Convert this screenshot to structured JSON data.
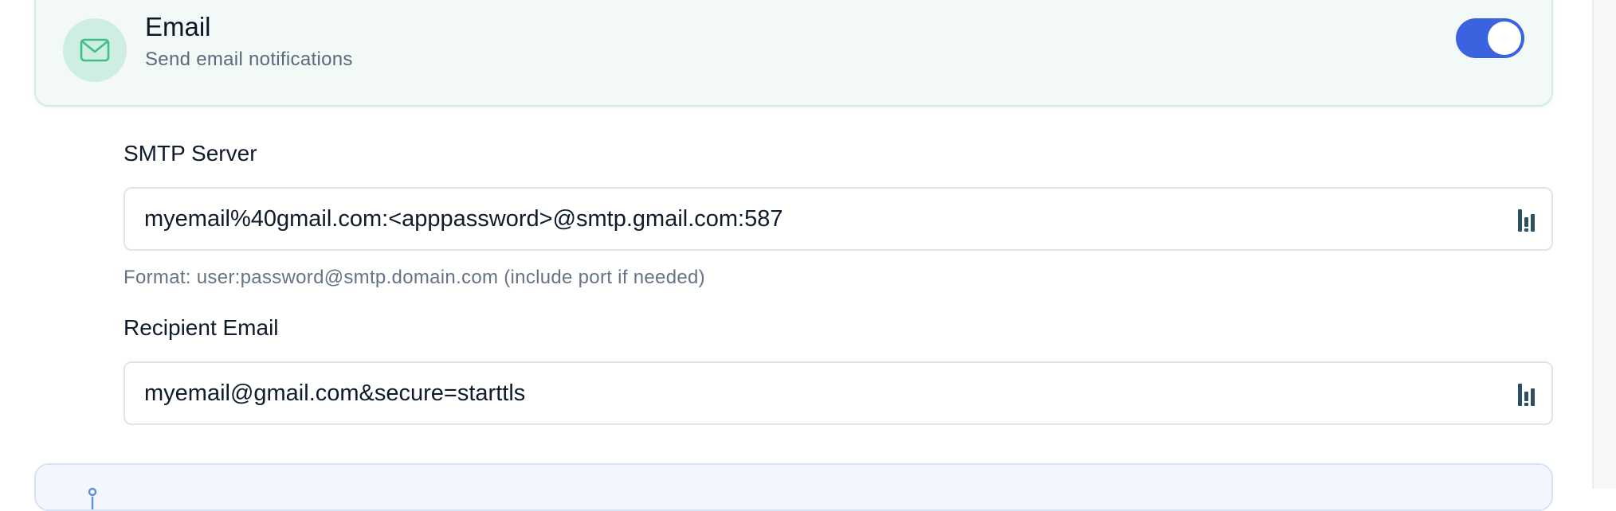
{
  "email_card": {
    "title": "Email",
    "subtitle": "Send email notifications",
    "icon": "mail-icon",
    "enabled": true
  },
  "fields": {
    "smtp": {
      "label": "SMTP Server",
      "value": "myemail%40gmail.com:<apppassword>@smtp.gmail.com:587",
      "help": "Format: user:password@smtp.domain.com (include port if needed)",
      "icon": "password-manager-icon"
    },
    "recipient": {
      "label": "Recipient Email",
      "value": "myemail@gmail.com&secure=starttls",
      "icon": "password-manager-icon"
    }
  },
  "info_card": {
    "icon": "info-icon"
  },
  "colors": {
    "accent": "#3b63e0",
    "card_bg": "#f2f9f6",
    "card_border": "#cfeee3",
    "icon_bg": "#cdeee1",
    "icon_stroke": "#3fbf8a",
    "info_bg": "#f3f7fd"
  }
}
